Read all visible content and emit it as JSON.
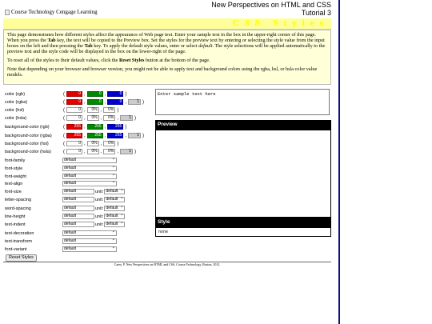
{
  "header": {
    "logo_alt": "Course Technology Cengage Learning",
    "title_line1": "New Perspectives on HTML and CSS",
    "title_line2": "Tutorial 3"
  },
  "banner": {
    "text": "CSS Styles"
  },
  "intro": {
    "p1_a": "This page demonstrates how different styles affect the appearance of Web page text. Enter your sample text in the box in the upper-right corner of this page. When you press the ",
    "p1_tab1": "Tab",
    "p1_b": " key, the text will be copied to the Preview box. Set the styles for the preview text by entering or selecting the style value from the input boxes on the left and then pressing the ",
    "p1_tab2": "Tab",
    "p1_c": " key. To apply the default style values, enter or select ",
    "p1_default": "default",
    "p1_d": ". The style selections will be applied automatically to the preview text and the style code will be displayed in the box on the lower-right of the page.",
    "p2_a": "To reset all of the styles to their default values, click the ",
    "p2_reset": "Reset Styles",
    "p2_b": " button at the bottom of the page.",
    "p3": "Note that depending on your browser and browser version, you might not be able to apply text and background colors using the rgba, hsl, or hsla color value models."
  },
  "colors": {
    "color_rgb": {
      "label": "color (rgb)",
      "r": "0",
      "g": "0",
      "b": "0"
    },
    "color_rgba": {
      "label": "color (rgba)",
      "r": "0",
      "g": "0",
      "b": "0",
      "a": "1"
    },
    "color_hsl": {
      "label": "color (hsl)",
      "h": "0",
      "s": "0%",
      "l": "0%"
    },
    "color_hsla": {
      "label": "color (hsla)",
      "h": "0",
      "s": "0%",
      "l": "0%",
      "a": "1"
    },
    "bg_rgb": {
      "label": "background-color (rgb)",
      "r": "255",
      "g": "255",
      "b": "255"
    },
    "bg_rgba": {
      "label": "background-color (rgba)",
      "r": "255",
      "g": "255",
      "b": "255",
      "a": "1"
    },
    "bg_hsl": {
      "label": "background-color (hsl)",
      "h": "0",
      "s": "0%",
      "l": "0%"
    },
    "bg_hsla": {
      "label": "background-color (hsla)",
      "h": "0",
      "s": "0%",
      "l": "0%",
      "a": "1"
    }
  },
  "selects": {
    "font_family": {
      "label": "font-family",
      "value": "default"
    },
    "font_style": {
      "label": "font-style",
      "value": "default"
    },
    "font_weight": {
      "label": "font-weight",
      "value": "default"
    },
    "text_align": {
      "label": "text-align",
      "value": "default"
    },
    "text_decoration": {
      "label": "text-decoration",
      "value": "default"
    },
    "text_transform": {
      "label": "text-transform",
      "value": "default"
    },
    "font_variant": {
      "label": "font-variant",
      "value": "default"
    }
  },
  "sizes": {
    "unit_label": "unit:",
    "font_size": {
      "label": "font-size",
      "value": "default",
      "unit": "default"
    },
    "letter_spacing": {
      "label": "letter-spacing",
      "value": "default",
      "unit": "default"
    },
    "word_spacing": {
      "label": "word-spacing",
      "value": "default",
      "unit": "default"
    },
    "line_height": {
      "label": "line-height",
      "value": "default",
      "unit": "default"
    },
    "text_indent": {
      "label": "text-indent",
      "value": "default",
      "unit": "default"
    }
  },
  "reset_button": "Reset Styles",
  "sample": {
    "placeholder": "Enter sample text here"
  },
  "preview": {
    "heading": "Preview"
  },
  "style": {
    "heading": "Style",
    "code": "none"
  },
  "footer": "Carey, P. New Perspectives on HTML and CSS, Course Technology, Boston, 2012.",
  "palette": {
    "red": "#e00000",
    "green": "#008800",
    "blue": "#0000cc",
    "banner_bg": "#ffff99",
    "intro_bg": "#ffffd8"
  }
}
